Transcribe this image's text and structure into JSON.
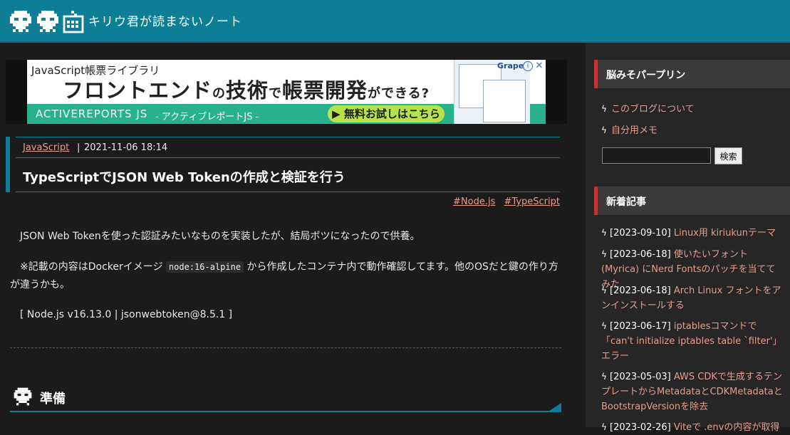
{
  "header": {
    "site_title": "キリウ君が読まないノート",
    "logo_icons": [
      "pixel-face-icon",
      "pixel-face-icon",
      "pixel-robot-icon"
    ]
  },
  "ad": {
    "top_text": "JavaScript帳票ライブラリ",
    "headline_a": "フロントエンド",
    "headline_b": "の",
    "headline_c": "技術",
    "headline_d": "で",
    "headline_e": "帳票開発",
    "headline_f": "ができる?",
    "brand": "ACTIVEREPORTS JS",
    "brand_sub": "- アクティブレポートJS -",
    "cta": "▶ 無料お試しはこちら",
    "close": "✕",
    "info": "i",
    "corner_text": "Grape",
    "colors": {
      "bar": "#27b18d",
      "cta": "#b7e34a"
    }
  },
  "article": {
    "category": "JavaScript",
    "separator": "|",
    "date": "2021-11-06 18:14",
    "title": "TypeScriptでJSON Web Tokenの作成と検証を行う",
    "tags": [
      "#Node.js",
      "#TypeScript"
    ],
    "para1": "JSON Web Tokenを使った認証みたいなものを実装したが、結局ボツになったので供養。",
    "para2_before": "※記載の内容はDockerイメージ ",
    "para2_code": "node:16-alpine",
    "para2_after": " から作成したコンテナ内で動作確認してます。他のOSだと鍵の作り方が違うかも。",
    "para3": "[ Node.js v16.13.0 | jsonwebtoken@8.5.1 ]",
    "section_title": "準備"
  },
  "sidebar": {
    "widget1_title": "脳みそパープリン",
    "links": [
      "このブログについて",
      "自分用メモ"
    ],
    "search": {
      "value": "",
      "button": "検索"
    },
    "widget2_title": "新着記事",
    "recent": [
      {
        "date": "[2023-09-10]",
        "title": "Linux用 kiriukunテーマ"
      },
      {
        "date": "[2023-06-18]",
        "title": "使いたいフォント (Myrica) にNerd Fontsのパッチを当ててみた"
      },
      {
        "date": "[2023-06-18]",
        "title": "Arch Linux フォントをアンインストールする"
      },
      {
        "date": "[2023-06-17]",
        "title": "iptablesコマンドで「can't initialize iptables table `filter'」エラー"
      },
      {
        "date": "[2023-05-03]",
        "title": "AWS CDKで生成するテンプレートからMetadataとCDKMetadataとBootstrapVersionを除去"
      },
      {
        "date": "[2023-02-26]",
        "title": "Viteで .envの内容が取得"
      }
    ]
  },
  "colors": {
    "header": "#0c7f97",
    "accent_red": "#c23333",
    "link": "#e89b8b"
  }
}
